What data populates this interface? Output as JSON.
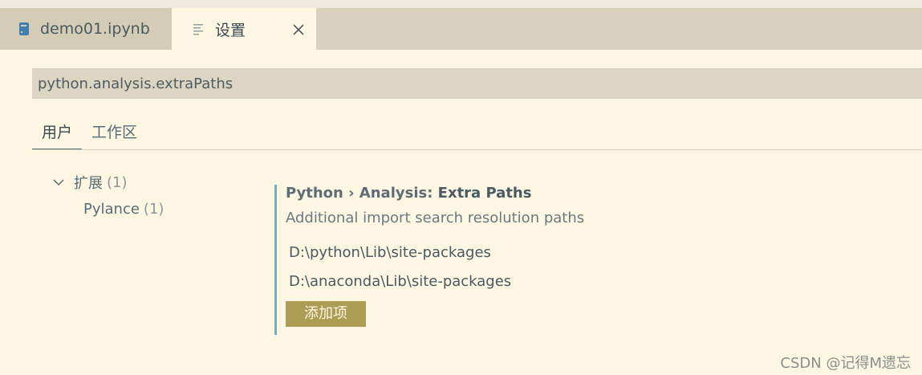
{
  "tabs": [
    {
      "label": "demo01.ipynb",
      "icon": "notebook-icon",
      "active": false
    },
    {
      "label": "设置",
      "icon": "settings-lines-icon",
      "active": true
    }
  ],
  "search": {
    "value": "python.analysis.extraPaths"
  },
  "scope_tabs": [
    "用户",
    "工作区"
  ],
  "toc": {
    "group_label": "扩展",
    "group_count": "(1)",
    "child_label": "Pylance",
    "child_count": "(1)"
  },
  "setting": {
    "category": "Python › Analysis: ",
    "name": "Extra Paths",
    "description": "Additional import search resolution paths",
    "paths": [
      "D:\\python\\Lib\\site-packages",
      "D:\\anaconda\\Lib\\site-packages"
    ],
    "add_button_label": "添加项"
  },
  "watermark": "CSDN @记得M遗忘",
  "colors": {
    "background": "#fdf6e3",
    "tabbar": "#d9d0bd",
    "accent_border": "#7aa9c8",
    "button": "#ad9c54"
  }
}
